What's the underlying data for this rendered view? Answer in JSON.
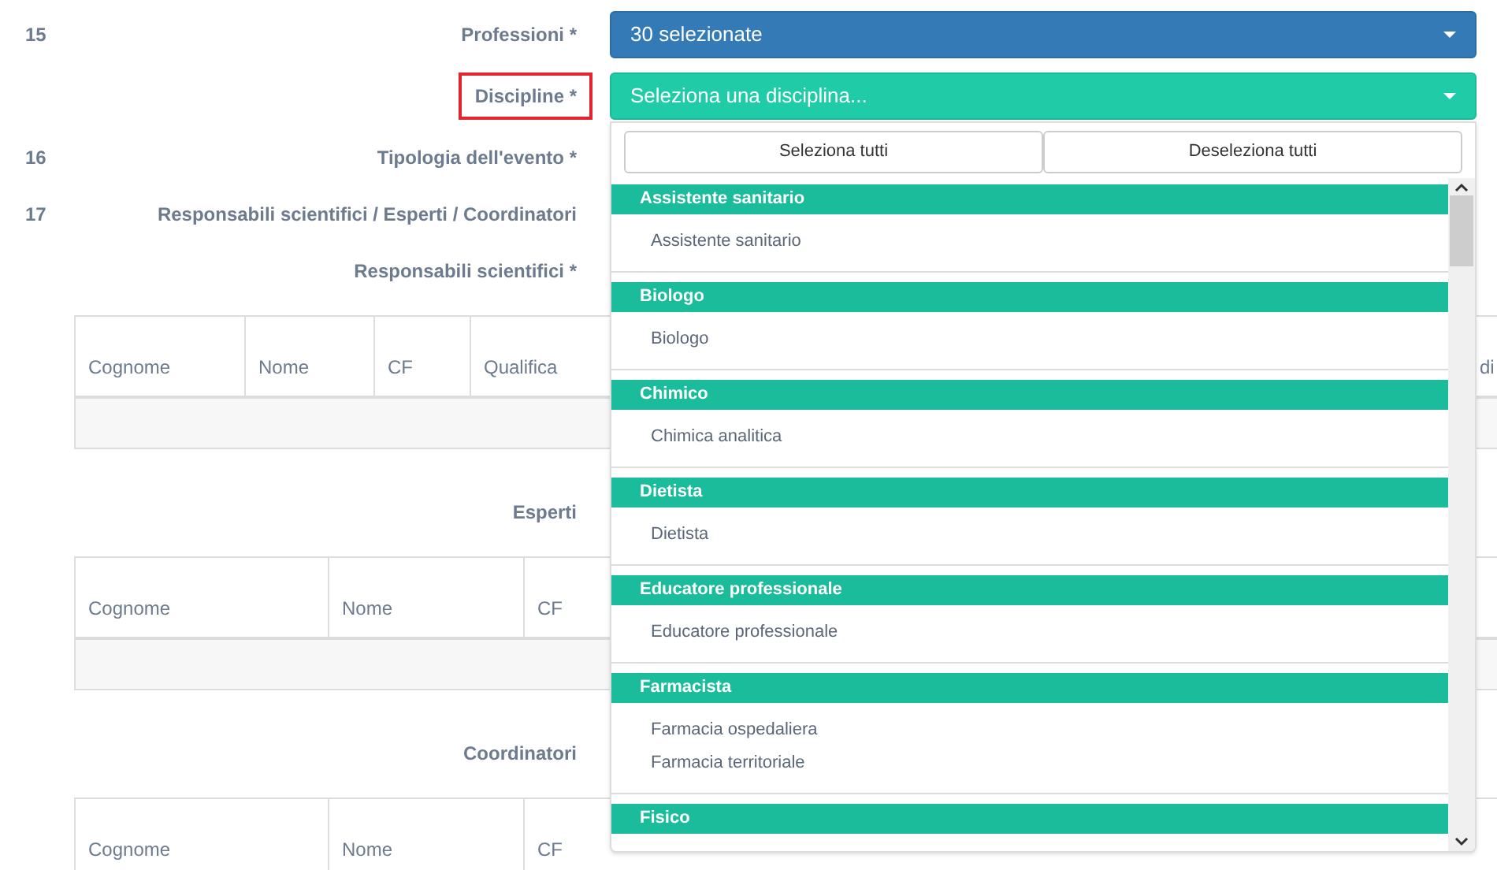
{
  "rows": [
    {
      "kind": "select",
      "number": "15",
      "label": "Professioni *",
      "value": "30 selezionate",
      "highlighted": false
    },
    {
      "kind": "select",
      "label": "Discipline *",
      "placeholder": "Seleziona una disciplina...",
      "highlighted": true,
      "dropdown": {
        "buttons": [
          "Seleziona tutti",
          "Deseleziona tutti"
        ],
        "groups": [
          {
            "label": "Assistente sanitario",
            "items": [
              "Assistente sanitario"
            ]
          },
          {
            "label": "Biologo",
            "items": [
              "Biologo"
            ]
          },
          {
            "label": "Chimico",
            "items": [
              "Chimica analitica"
            ]
          },
          {
            "label": "Dietista",
            "items": [
              "Dietista"
            ]
          },
          {
            "label": "Educatore professionale",
            "items": [
              "Educatore professionale"
            ]
          },
          {
            "label": "Farmacista",
            "items": [
              "Farmacia ospedaliera",
              "Farmacia territoriale"
            ]
          },
          {
            "label": "Fisico"
          }
        ]
      }
    },
    {
      "kind": "label",
      "number": "16",
      "label": "Tipologia dell'evento *"
    },
    {
      "kind": "label",
      "number": "17",
      "label": "Responsabili scientifici / Esperti / Coordinatori"
    },
    {
      "kind": "label",
      "label": "Responsabili scientifici *"
    },
    {
      "kind": "table",
      "columns": [
        "Cognome",
        "Nome",
        "CF",
        "Qualifica",
        "di"
      ]
    },
    {
      "kind": "label",
      "label": "Esperti"
    },
    {
      "kind": "table",
      "columns": [
        "Cognome",
        "Nome",
        "CF"
      ]
    },
    {
      "kind": "label",
      "label": "Coordinatori"
    },
    {
      "kind": "table",
      "columns": [
        "Cognome",
        "Nome",
        "CF"
      ]
    }
  ]
}
